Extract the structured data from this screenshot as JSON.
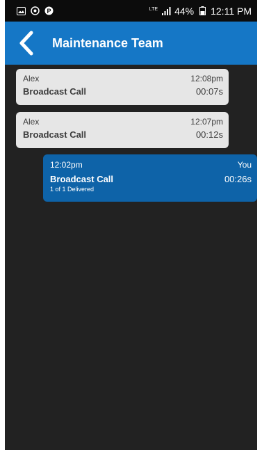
{
  "status": {
    "network": "LTE",
    "battery": "44%",
    "time": "12:11 PM"
  },
  "header": {
    "title": "Maintenance Team"
  },
  "messages": [
    {
      "sender": "Alex",
      "time": "12:08pm",
      "title": "Broadcast Call",
      "duration": "00:07s"
    },
    {
      "sender": "Alex",
      "time": "12:07pm",
      "title": "Broadcast Call",
      "duration": "00:12s"
    }
  ],
  "outgoing": {
    "time": "12:02pm",
    "sender": "You",
    "title": "Broadcast Call",
    "duration": "00:26s",
    "delivery": "1 of 1 Delivered"
  },
  "colors": {
    "header": "#1577c6",
    "outgoing_bubble": "#0e63a8",
    "incoming_bubble": "#e6e6e6",
    "background": "#222222"
  }
}
